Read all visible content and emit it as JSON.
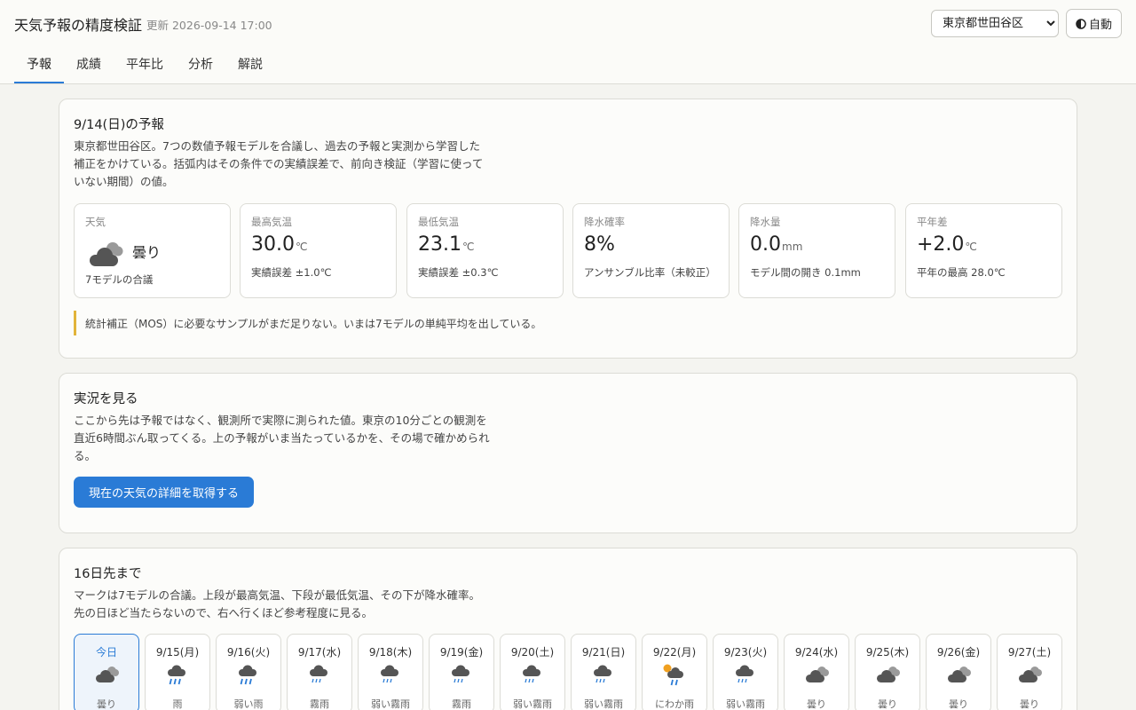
{
  "header": {
    "title": "天気予報の精度検証",
    "updated": "更新 2026-09-14 17:00",
    "region": "東京都世田谷区",
    "theme_icon": "half-circle-icon",
    "theme_label": "自動"
  },
  "tabs": [
    "予報",
    "成績",
    "平年比",
    "分析",
    "解説"
  ],
  "forecast": {
    "title": "9/14(日)の予報",
    "desc": "東京都世田谷区。7つの数値予報モデルを合議し、過去の予報と実測から学習した補正をかけている。括弧内はその条件での実績誤差で、前向き検証（学習に使っていない期間）の値。",
    "weather": {
      "label": "天気",
      "value": "曇り",
      "sub": "7モデルの合議",
      "icon": "cloudy-icon"
    },
    "high": {
      "label": "最高気温",
      "value": "30.0",
      "unit": "℃",
      "sub": "実績誤差 ±1.0℃"
    },
    "low": {
      "label": "最低気温",
      "value": "23.1",
      "unit": "℃",
      "sub": "実績誤差 ±0.3℃"
    },
    "pop": {
      "label": "降水確率",
      "value": "8%",
      "unit": "",
      "sub": "アンサンブル比率（未較正）"
    },
    "precip": {
      "label": "降水量",
      "value": "0.0",
      "unit": "mm",
      "sub": "モデル間の開き 0.1mm"
    },
    "normal": {
      "label": "平年差",
      "value": "+2.0",
      "unit": "℃",
      "sub": "平年の最高 28.0℃"
    },
    "note": "統計補正（MOS）に必要なサンプルがまだ足りない。いまは7モデルの単純平均を出している。"
  },
  "observed": {
    "title": "実況を見る",
    "desc": "ここから先は予報ではなく、観測所で実際に測られた値。東京の10分ごとの観測を直近6時間ぶん取ってくる。上の予報がいま当たっているかを、その場で確かめられる。",
    "button": "現在の天気の詳細を取得する"
  },
  "longrange": {
    "title": "16日先まで",
    "desc": "マークは7モデルの合議。上段が最高気温、下段が最低気温、その下が降水確率。先の日ほど当たらないので、右へ行くほど参考程度に見る。",
    "days": [
      {
        "date": "今日",
        "cond": "曇り",
        "icon": "cloudy"
      },
      {
        "date": "9/15(月)",
        "cond": "雨",
        "icon": "rain"
      },
      {
        "date": "9/16(火)",
        "cond": "弱い雨",
        "icon": "rain"
      },
      {
        "date": "9/17(水)",
        "cond": "霧雨",
        "icon": "drizzle"
      },
      {
        "date": "9/18(木)",
        "cond": "弱い霧雨",
        "icon": "drizzle"
      },
      {
        "date": "9/19(金)",
        "cond": "霧雨",
        "icon": "drizzle"
      },
      {
        "date": "9/20(土)",
        "cond": "弱い霧雨",
        "icon": "drizzle"
      },
      {
        "date": "9/21(日)",
        "cond": "弱い霧雨",
        "icon": "drizzle"
      },
      {
        "date": "9/22(月)",
        "cond": "にわか雨",
        "icon": "showers"
      },
      {
        "date": "9/23(火)",
        "cond": "弱い霧雨",
        "icon": "drizzle"
      },
      {
        "date": "9/24(水)",
        "cond": "曇り",
        "icon": "cloudy"
      },
      {
        "date": "9/25(木)",
        "cond": "曇り",
        "icon": "cloudy"
      },
      {
        "date": "9/26(金)",
        "cond": "曇り",
        "icon": "cloudy"
      },
      {
        "date": "9/27(土)",
        "cond": "曇り",
        "icon": "cloudy"
      }
    ]
  }
}
